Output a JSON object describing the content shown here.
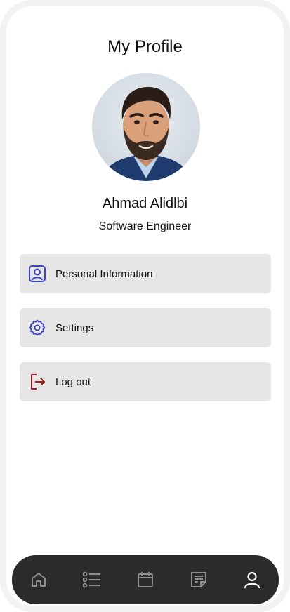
{
  "header": {
    "title": "My Profile"
  },
  "profile": {
    "name": "Ahmad Alidlbi",
    "role": "Software Engineer"
  },
  "menu": {
    "items": [
      {
        "label": "Personal Information",
        "icon": "user-card-icon",
        "color": "#3f43c9"
      },
      {
        "label": "Settings",
        "icon": "gear-icon",
        "color": "#3f43c9"
      },
      {
        "label": "Log out",
        "icon": "logout-icon",
        "color": "#9b1c1c"
      }
    ]
  },
  "tabbar": {
    "tabs": [
      {
        "icon": "home-icon",
        "active": false
      },
      {
        "icon": "list-icon",
        "active": false
      },
      {
        "icon": "calendar-icon",
        "active": false
      },
      {
        "icon": "notes-icon",
        "active": false
      },
      {
        "icon": "user-icon",
        "active": true
      }
    ],
    "inactive_color": "#8e8e8e",
    "active_color": "#ffffff",
    "background": "#2b2b2b"
  }
}
